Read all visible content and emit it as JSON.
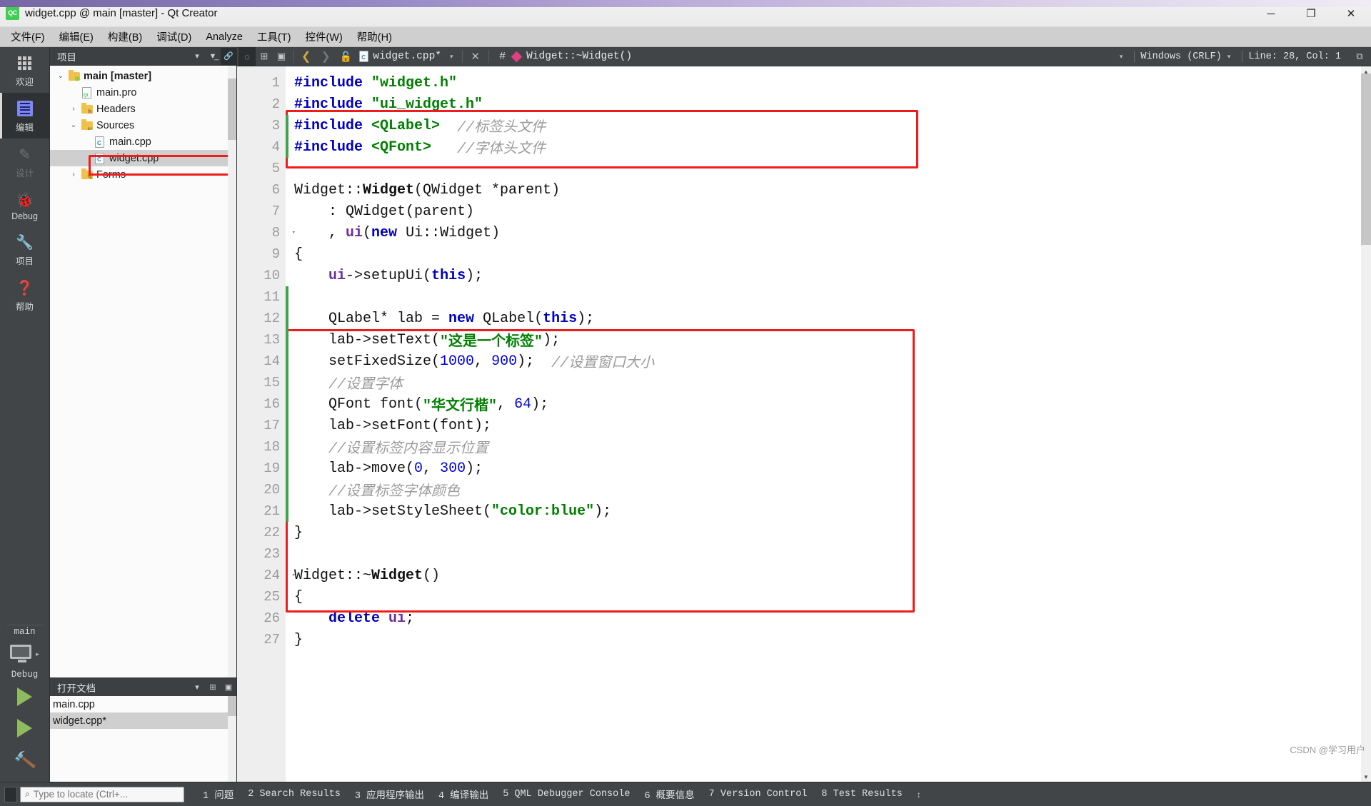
{
  "window": {
    "title": "widget.cpp @ main [master] - Qt Creator",
    "logo_text": "QC",
    "minimize": "─",
    "maximize": "❐",
    "close": "✕"
  },
  "menubar": {
    "items": [
      {
        "label": "文件(F)",
        "name": "menu-file"
      },
      {
        "label": "编辑(E)",
        "name": "menu-edit"
      },
      {
        "label": "构建(B)",
        "name": "menu-build"
      },
      {
        "label": "调试(D)",
        "name": "menu-debug"
      },
      {
        "label": "Analyze",
        "name": "menu-analyze"
      },
      {
        "label": "工具(T)",
        "name": "menu-tools"
      },
      {
        "label": "控件(W)",
        "name": "menu-widgets"
      },
      {
        "label": "帮助(H)",
        "name": "menu-help"
      }
    ]
  },
  "modebar": {
    "items": [
      {
        "label": "欢迎",
        "icon": "grid-icon",
        "active": false,
        "disabled": false
      },
      {
        "label": "编辑",
        "icon": "edit-icon",
        "active": true,
        "disabled": false
      },
      {
        "label": "设计",
        "icon": "pencil-icon",
        "active": false,
        "disabled": true
      },
      {
        "label": "Debug",
        "icon": "bug-icon",
        "active": false,
        "disabled": false
      },
      {
        "label": "项目",
        "icon": "wrench-icon",
        "active": false,
        "disabled": false
      },
      {
        "label": "帮助",
        "icon": "question-icon",
        "active": false,
        "disabled": false
      }
    ],
    "kit_name": "main",
    "build_config": "Debug",
    "run_label": "run-button",
    "debug_label": "debug-button",
    "build_label": "build-button"
  },
  "leftdock": {
    "projects_title": "项目",
    "opendocs_title": "打开文档",
    "tree": [
      {
        "label": "main [master]",
        "indent": 0,
        "twisty": "⌄",
        "icon": "folder-qt-icon",
        "bold": true,
        "selected": false
      },
      {
        "label": "main.pro",
        "indent": 1,
        "twisty": "",
        "icon": "file-qt-icon",
        "bold": false,
        "selected": false
      },
      {
        "label": "Headers",
        "indent": 1,
        "twisty": "›",
        "icon": "folder-h-icon",
        "bold": false,
        "selected": false
      },
      {
        "label": "Sources",
        "indent": 1,
        "twisty": "⌄",
        "icon": "folder-cpp-icon",
        "bold": false,
        "selected": false
      },
      {
        "label": "main.cpp",
        "indent": 2,
        "twisty": "",
        "icon": "file-cpp-icon",
        "bold": false,
        "selected": false
      },
      {
        "label": "widget.cpp",
        "indent": 2,
        "twisty": "",
        "icon": "file-cpp-icon",
        "bold": false,
        "selected": true
      },
      {
        "label": "Forms",
        "indent": 1,
        "twisty": "›",
        "icon": "folder-forms-icon",
        "bold": false,
        "selected": false
      }
    ],
    "opendocs": [
      {
        "label": "main.cpp",
        "active": false
      },
      {
        "label": "widget.cpp*",
        "active": true
      }
    ]
  },
  "editor_toolbar": {
    "back": "❮",
    "forward": "❯",
    "lock": "🔓",
    "file_name": "widget.cpp*",
    "dropdown_caret": "▾",
    "close": "✕",
    "hash": "#",
    "symbol": "Widget::~Widget()",
    "line_ending": "Windows (CRLF)",
    "cursor_position": "Line: 28, Col: 1",
    "split_icon": "⧉"
  },
  "code": {
    "first_line": 1,
    "lines": [
      {
        "n": 1,
        "tokens": [
          {
            "t": "#include ",
            "c": "pp"
          },
          {
            "t": "\"widget.h\"",
            "c": "str"
          }
        ],
        "fold": false,
        "changed": false
      },
      {
        "n": 2,
        "tokens": [
          {
            "t": "#include ",
            "c": "pp"
          },
          {
            "t": "\"ui_widget.h\"",
            "c": "str"
          }
        ],
        "fold": false,
        "changed": false
      },
      {
        "n": 3,
        "tokens": [
          {
            "t": "#include ",
            "c": "pp"
          },
          {
            "t": "<QLabel>",
            "c": "str"
          },
          {
            "t": "  ",
            "c": "typ"
          },
          {
            "t": "//标签头文件",
            "c": "cmt"
          }
        ],
        "fold": false,
        "changed": true
      },
      {
        "n": 4,
        "tokens": [
          {
            "t": "#include ",
            "c": "pp"
          },
          {
            "t": "<QFont>",
            "c": "str"
          },
          {
            "t": "   ",
            "c": "typ"
          },
          {
            "t": "//字体头文件",
            "c": "cmt"
          }
        ],
        "fold": false,
        "changed": true
      },
      {
        "n": 5,
        "tokens": [],
        "fold": false,
        "changed": false
      },
      {
        "n": 6,
        "tokens": [
          {
            "t": "Widget::",
            "c": "typ"
          },
          {
            "t": "Widget",
            "c": "fnb"
          },
          {
            "t": "(QWidget *parent)",
            "c": "typ"
          }
        ],
        "fold": false,
        "changed": false
      },
      {
        "n": 7,
        "tokens": [
          {
            "t": "    : QWidget(parent)",
            "c": "typ"
          }
        ],
        "fold": false,
        "changed": false
      },
      {
        "n": 8,
        "tokens": [
          {
            "t": "    , ",
            "c": "typ"
          },
          {
            "t": "ui",
            "c": "fld"
          },
          {
            "t": "(",
            "c": "typ"
          },
          {
            "t": "new",
            "c": "kw"
          },
          {
            "t": " Ui::Widget)",
            "c": "typ"
          }
        ],
        "fold": true,
        "changed": false
      },
      {
        "n": 9,
        "tokens": [
          {
            "t": "{",
            "c": "typ"
          }
        ],
        "fold": false,
        "changed": false
      },
      {
        "n": 10,
        "tokens": [
          {
            "t": "    ",
            "c": "typ"
          },
          {
            "t": "ui",
            "c": "fld"
          },
          {
            "t": "->setupUi(",
            "c": "typ"
          },
          {
            "t": "this",
            "c": "kw"
          },
          {
            "t": ");",
            "c": "typ"
          }
        ],
        "fold": false,
        "changed": false
      },
      {
        "n": 11,
        "tokens": [],
        "fold": false,
        "changed": true
      },
      {
        "n": 12,
        "tokens": [
          {
            "t": "    QLabel* lab = ",
            "c": "typ"
          },
          {
            "t": "new",
            "c": "kw"
          },
          {
            "t": " QLabel(",
            "c": "typ"
          },
          {
            "t": "this",
            "c": "kw"
          },
          {
            "t": ");",
            "c": "typ"
          }
        ],
        "fold": false,
        "changed": true
      },
      {
        "n": 13,
        "tokens": [
          {
            "t": "    lab->setText(",
            "c": "typ"
          },
          {
            "t": "\"这是一个标签\"",
            "c": "str"
          },
          {
            "t": ");",
            "c": "typ"
          }
        ],
        "fold": false,
        "changed": true
      },
      {
        "n": 14,
        "tokens": [
          {
            "t": "    setFixedSize(",
            "c": "typ"
          },
          {
            "t": "1000",
            "c": "num"
          },
          {
            "t": ", ",
            "c": "typ"
          },
          {
            "t": "900",
            "c": "num"
          },
          {
            "t": ");  ",
            "c": "typ"
          },
          {
            "t": "//设置窗口大小",
            "c": "cmt"
          }
        ],
        "fold": false,
        "changed": true
      },
      {
        "n": 15,
        "tokens": [
          {
            "t": "    ",
            "c": "typ"
          },
          {
            "t": "//设置字体",
            "c": "cmt"
          }
        ],
        "fold": false,
        "changed": true
      },
      {
        "n": 16,
        "tokens": [
          {
            "t": "    QFont font(",
            "c": "typ"
          },
          {
            "t": "\"华文行楷\"",
            "c": "str"
          },
          {
            "t": ", ",
            "c": "typ"
          },
          {
            "t": "64",
            "c": "num"
          },
          {
            "t": ");",
            "c": "typ"
          }
        ],
        "fold": false,
        "changed": true
      },
      {
        "n": 17,
        "tokens": [
          {
            "t": "    lab->setFont(font);",
            "c": "typ"
          }
        ],
        "fold": false,
        "changed": true
      },
      {
        "n": 18,
        "tokens": [
          {
            "t": "    ",
            "c": "typ"
          },
          {
            "t": "//设置标签内容显示位置",
            "c": "cmt"
          }
        ],
        "fold": false,
        "changed": true
      },
      {
        "n": 19,
        "tokens": [
          {
            "t": "    lab->move(",
            "c": "typ"
          },
          {
            "t": "0",
            "c": "num"
          },
          {
            "t": ", ",
            "c": "typ"
          },
          {
            "t": "300",
            "c": "num"
          },
          {
            "t": ");",
            "c": "typ"
          }
        ],
        "fold": false,
        "changed": true
      },
      {
        "n": 20,
        "tokens": [
          {
            "t": "    ",
            "c": "typ"
          },
          {
            "t": "//设置标签字体颜色",
            "c": "cmt"
          }
        ],
        "fold": false,
        "changed": true
      },
      {
        "n": 21,
        "tokens": [
          {
            "t": "    lab->setStyleSheet(",
            "c": "typ"
          },
          {
            "t": "\"color:blue\"",
            "c": "str"
          },
          {
            "t": ");",
            "c": "typ"
          }
        ],
        "fold": false,
        "changed": true
      },
      {
        "n": 22,
        "tokens": [
          {
            "t": "}",
            "c": "typ"
          }
        ],
        "fold": false,
        "changed": false
      },
      {
        "n": 23,
        "tokens": [],
        "fold": false,
        "changed": false
      },
      {
        "n": 24,
        "tokens": [
          {
            "t": "Widget::~",
            "c": "typ"
          },
          {
            "t": "Widget",
            "c": "fnb"
          },
          {
            "t": "()",
            "c": "typ"
          }
        ],
        "fold": true,
        "changed": false
      },
      {
        "n": 25,
        "tokens": [
          {
            "t": "{",
            "c": "typ"
          }
        ],
        "fold": false,
        "changed": false
      },
      {
        "n": 26,
        "tokens": [
          {
            "t": "    ",
            "c": "typ"
          },
          {
            "t": "delete",
            "c": "kw"
          },
          {
            "t": " ",
            "c": "typ"
          },
          {
            "t": "ui",
            "c": "fld"
          },
          {
            "t": ";",
            "c": "typ"
          }
        ],
        "fold": false,
        "changed": false
      },
      {
        "n": 27,
        "tokens": [
          {
            "t": "}",
            "c": "typ"
          }
        ],
        "fold": false,
        "changed": false
      }
    ],
    "highlight_color": "#ee1c1c"
  },
  "statusbar": {
    "locator_placeholder": "Type to locate (Ctrl+...",
    "search_icon": "⌕",
    "tabs": [
      {
        "label": "1 问题"
      },
      {
        "label": "2 Search Results"
      },
      {
        "label": "3 应用程序输出"
      },
      {
        "label": "4 编译输出"
      },
      {
        "label": "5 QML Debugger Console"
      },
      {
        "label": "6 概要信息"
      },
      {
        "label": "7 Version Control"
      },
      {
        "label": "8 Test Results"
      }
    ],
    "updown": "↕"
  },
  "watermark": "CSDN @学习用户"
}
